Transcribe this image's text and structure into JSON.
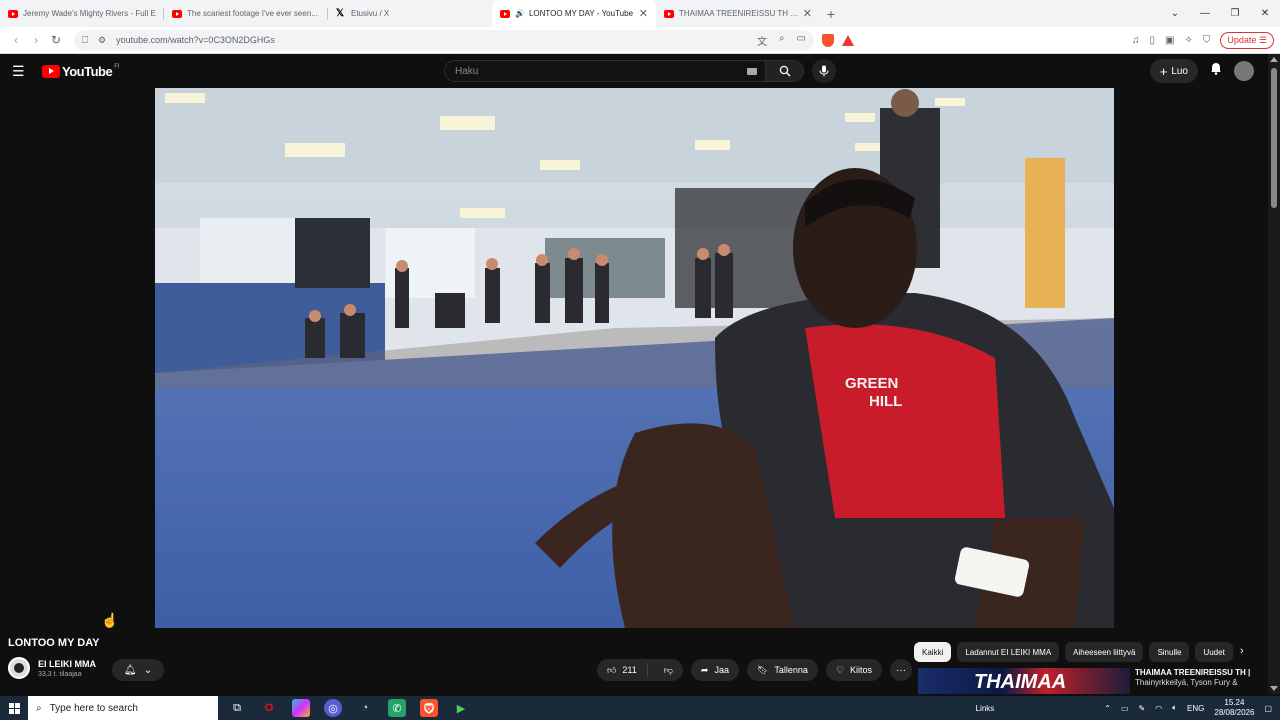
{
  "browser": {
    "tabs": [
      {
        "title": "Jeremy Wade's Mighty Rivers - Full E",
        "icon": "youtube-icon",
        "active": false
      },
      {
        "title": "The scariest footage I've ever seen...",
        "icon": "youtube-icon",
        "active": false
      },
      {
        "title": "Etusivu / X",
        "icon": "x-icon",
        "active": false
      },
      {
        "title": "LONTOO MY DAY - YouTube",
        "icon": "youtube-icon",
        "active": true
      },
      {
        "title": "THAIMAA TREENIREISSU TH | Thainyr",
        "icon": "youtube-icon",
        "active": false
      }
    ],
    "new_tab": "+",
    "url": "youtube.com/watch?v=0C3ON2DGHGs",
    "update_label": "Update"
  },
  "youtube": {
    "logo_text": "YouTube",
    "logo_region": "FI",
    "search_placeholder": "Haku",
    "create_label": "Luo",
    "video_title": "LONTOO MY DAY",
    "channel_name": "EI LEIKI MMA",
    "subscribers": "33,3 t. tilaajaa",
    "like_count": "211",
    "share_label": "Jaa",
    "save_label": "Tallenna",
    "thanks_label": "Kiitos",
    "more_label": "···",
    "chips": [
      "Kaikki",
      "Ladannut EI LEIKI MMA",
      "Aiheeseen liittyvä",
      "Sinulle",
      "Uudet"
    ],
    "recommended": {
      "thumb_text": "THAIMAA",
      "title": "THAIMAA TREENIREISSU TH |",
      "subtitle": "Thainyrkkeilyä, Tyson Fury &"
    }
  },
  "taskbar": {
    "search_placeholder": "Type here to search",
    "links_label": "Links",
    "language": "ENG",
    "time": "15.24",
    "date": "28/08/2026"
  },
  "colors": {
    "youtube_red": "#ff0000",
    "yt_background": "#0f0f0f",
    "chip_bg": "#272727",
    "taskbar_bg": "#1b2a3a"
  }
}
